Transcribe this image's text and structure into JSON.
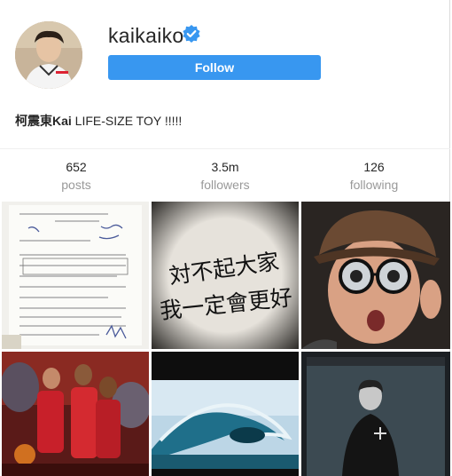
{
  "profile": {
    "username": "kaikaiko",
    "verified": true,
    "follow_label": "Follow",
    "bio_name": "柯震東Kai",
    "bio_text": " LIFE-SIZE TOY !!!!!"
  },
  "stats": [
    {
      "value": "652",
      "label": "posts"
    },
    {
      "value": "3.5m",
      "label": "followers"
    },
    {
      "value": "126",
      "label": "following"
    }
  ],
  "posts": [
    {
      "name": "post-handwritten-exam",
      "caption": ""
    },
    {
      "name": "post-calligraphy-apology",
      "calligraphy": [
        "対不起大家",
        "我一定會更好"
      ]
    },
    {
      "name": "post-selfie-glasses",
      "caption": ""
    },
    {
      "name": "post-rockets-illustration",
      "caption": ""
    },
    {
      "name": "post-ocean-wave",
      "caption": ""
    },
    {
      "name": "post-bw-portrait",
      "caption": ""
    }
  ],
  "colors": {
    "follow_blue": "#3897f0",
    "verified_blue": "#3897f0",
    "muted_text": "#999999"
  }
}
